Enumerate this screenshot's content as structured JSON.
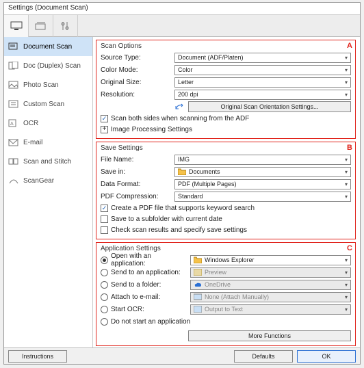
{
  "window": {
    "title": "Settings (Document Scan)"
  },
  "sidebar": {
    "items": [
      {
        "label": "Document Scan"
      },
      {
        "label": "Doc (Duplex) Scan"
      },
      {
        "label": "Photo Scan"
      },
      {
        "label": "Custom Scan"
      },
      {
        "label": "OCR"
      },
      {
        "label": "E-mail"
      },
      {
        "label": "Scan and Stitch"
      },
      {
        "label": "ScanGear"
      }
    ]
  },
  "scan": {
    "legend": "Scan Options",
    "letter": "A",
    "source_label": "Source Type:",
    "source_value": "Document (ADF/Platen)",
    "color_label": "Color Mode:",
    "color_value": "Color",
    "size_label": "Original Size:",
    "size_value": "Letter",
    "res_label": "Resolution:",
    "res_value": "200 dpi",
    "orient_btn": "Original Scan Orientation Settings...",
    "chk_both": "Scan both sides when scanning from the ADF",
    "img_proc": "Image Processing Settings"
  },
  "save": {
    "legend": "Save Settings",
    "letter": "B",
    "file_label": "File Name:",
    "file_value": "IMG",
    "savein_label": "Save in:",
    "savein_value": "Documents",
    "format_label": "Data Format:",
    "format_value": "PDF (Multiple Pages)",
    "pdf_label": "PDF Compression:",
    "pdf_value": "Standard",
    "chk_keyword": "Create a PDF file that supports keyword search",
    "chk_subfolder": "Save to a subfolder with current date",
    "chk_check": "Check scan results and specify save settings"
  },
  "app": {
    "legend": "Application Settings",
    "letter": "C",
    "open_label": "Open with an application:",
    "open_value": "Windows Explorer",
    "sendapp_label": "Send to an application:",
    "sendapp_value": "Preview",
    "folder_label": "Send to a folder:",
    "folder_value": "OneDrive",
    "email_label": "Attach to e-mail:",
    "email_value": "None (Attach Manually)",
    "ocr_label": "Start OCR:",
    "ocr_value": "Output to Text",
    "none_label": "Do not start an application",
    "more_btn": "More Functions"
  },
  "footer": {
    "instructions": "Instructions",
    "defaults": "Defaults",
    "ok": "OK"
  }
}
